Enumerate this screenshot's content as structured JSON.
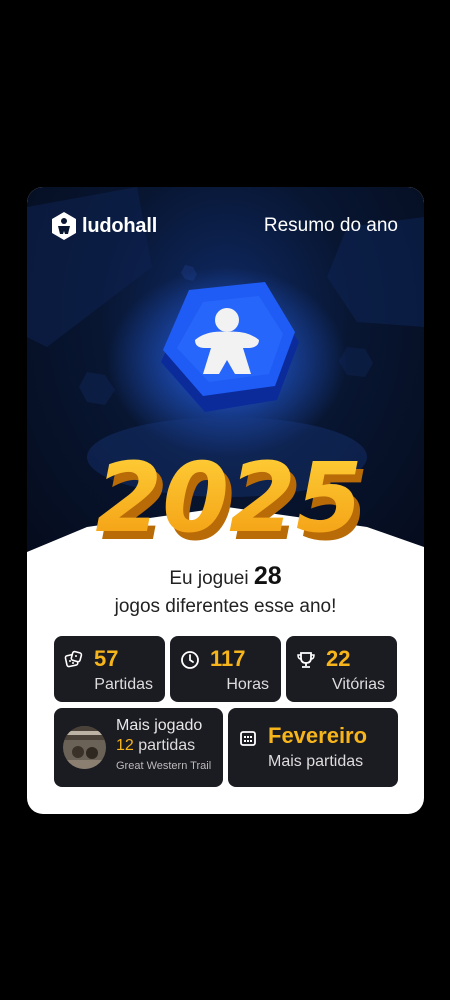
{
  "app": {
    "brand": "ludohall"
  },
  "header": {
    "title": "Resumo do ano"
  },
  "hero": {
    "year": "2025"
  },
  "summary": {
    "prefix": "Eu joguei",
    "count": "28",
    "suffix": "jogos diferentes esse ano!"
  },
  "stats": [
    {
      "icon": "dice-icon",
      "value": "57",
      "label": "Partidas"
    },
    {
      "icon": "clock-icon",
      "value": "117",
      "label": "Horas"
    },
    {
      "icon": "trophy-icon",
      "value": "22",
      "label": "Vitórias"
    }
  ],
  "most_played": {
    "title": "Mais jogado",
    "count": "12",
    "count_suffix": "partidas",
    "game": "Great Western Trail"
  },
  "top_month": {
    "icon": "calendar-icon",
    "value": "Fevereiro",
    "label": "Mais partidas"
  },
  "colors": {
    "accent": "#f7b51c",
    "tile": "#1b1b22",
    "hero_bg": "#081632",
    "badge": "#1e5bf0"
  }
}
